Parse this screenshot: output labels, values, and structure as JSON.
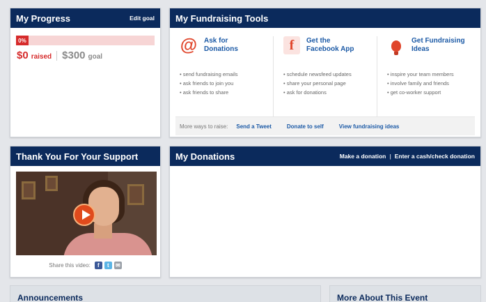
{
  "progress": {
    "title": "My Progress",
    "edit_goal": "Edit goal",
    "percent_label": "0%",
    "percent_value": 0,
    "raised_amount": "$0",
    "raised_label": "raised",
    "goal_amount": "$300",
    "goal_label": "goal",
    "colors": {
      "accent": "#d62b2b",
      "header": "#0b2a5c"
    }
  },
  "tools": {
    "title": "My Fundraising Tools",
    "items": [
      {
        "icon": "at-sign-icon",
        "glyph": "@",
        "title": "Ask for Donations",
        "bullets": [
          "send fundraising emails",
          "ask friends to join you",
          "ask friends to share"
        ]
      },
      {
        "icon": "facebook-icon",
        "glyph": "f",
        "title": "Get the Facebook App",
        "bullets": [
          "schedule newsfeed updates",
          "share your personal page",
          "ask for donations"
        ]
      },
      {
        "icon": "lightbulb-icon",
        "glyph": "",
        "title": "Get Fundraising Ideas",
        "bullets": [
          "inspire your team members",
          "involve family and friends",
          "get co-worker support"
        ]
      }
    ],
    "more_label": "More ways to raise:",
    "more_links": [
      "Send a Tweet",
      "Donate to self",
      "View fundraising ideas"
    ]
  },
  "thanks": {
    "title": "Thank You For Your Support",
    "share_label": "Share this video:",
    "share_icons": {
      "facebook": "f",
      "twitter": "t",
      "email": "✉"
    }
  },
  "donations": {
    "title": "My Donations",
    "make_donation": "Make a donation",
    "cash_check": "Enter a cash/check donation"
  },
  "announcements": {
    "title": "Announcements"
  },
  "more_event": {
    "title": "More About This Event"
  }
}
